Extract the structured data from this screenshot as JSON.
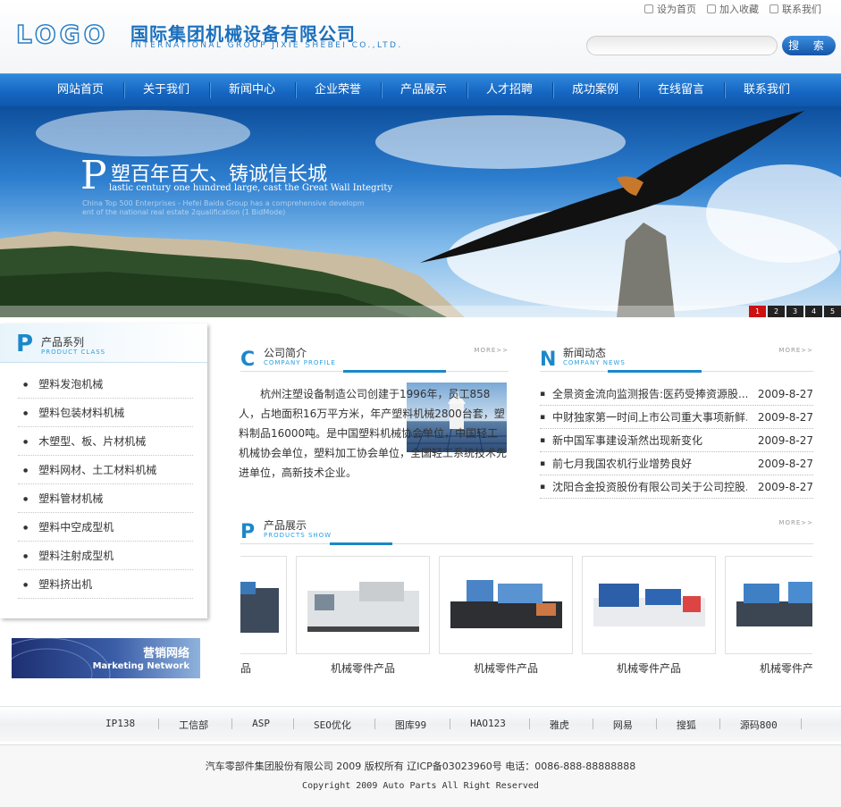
{
  "header": {
    "logo": "LOGO",
    "company_cn": "国际集团机械设备有限公司",
    "company_en": "INTERNATIONAL GROUP  JIXIE SHEBEI CO.,LTD.",
    "top_links": [
      "设为首页",
      "加入收藏",
      "联系我们"
    ],
    "search_button": "搜 索"
  },
  "nav": [
    "网站首页",
    "关于我们",
    "新闻中心",
    "企业荣誉",
    "产品展示",
    "人才招聘",
    "成功案例",
    "在线留言",
    "联系我们"
  ],
  "banner": {
    "slogan_letter": "P",
    "slogan_cn": "塑百年百大、铸诚信长城",
    "slogan_en": "lastic century one hundred large, cast the Great Wall Integrity",
    "sub1": "China Top 500 Enterprises - Hefei Baida Group has a comprehensive developm",
    "sub2": "ent of the national real estate 2qualification (1 BidMode)",
    "slides": [
      "1",
      "2",
      "3",
      "4",
      "5"
    ],
    "active_slide": 1
  },
  "sidebar": {
    "mark": "P",
    "title": "产品系列",
    "subtitle": "PRODUCT CLASS",
    "items": [
      "塑料发泡机械",
      "塑料包装材料机械",
      "木塑型、板、片材机械",
      "塑料网材、土工材料机械",
      "塑料管材机械",
      "塑料中空成型机",
      "塑料注射成型机",
      "塑料挤出机"
    ]
  },
  "marketing": {
    "cn": "营销网络",
    "en": "Marketing Network"
  },
  "profile": {
    "mark": "C",
    "title": "公司简介",
    "subtitle": "COMPANY PROFILE",
    "more": "MORE>>",
    "text": "杭州注塑设备制造公司创建于1996年，员工858人，占地面积16万平方米，年产塑料机械2800台套，塑料制品16000吨。是中国塑料机械协会单位，中国轻工机械协会单位，塑料加工协会单位，全国轻工系统技术先进单位，高新技术企业。"
  },
  "news": {
    "mark": "N",
    "title": "新闻动态",
    "subtitle": "COMPANY NEWS",
    "more": "MORE>>",
    "items": [
      {
        "title": "全景资金流向监测报告:医药受捧资源股...",
        "date": "2009-8-27"
      },
      {
        "title": "中财独家第一时间上市公司重大事项新鲜...",
        "date": "2009-8-27"
      },
      {
        "title": "新中国军事建设渐然出现新变化",
        "date": "2009-8-27"
      },
      {
        "title": "前七月我国农机行业增势良好",
        "date": "2009-8-27"
      },
      {
        "title": "沈阳合金投资股份有限公司关于公司控股...",
        "date": "2009-8-27"
      }
    ]
  },
  "products": {
    "mark": "P",
    "title": "产品展示",
    "subtitle": "PRODUCTS SHOW",
    "more": "MORE>>",
    "items": [
      "品",
      "机械零件产品",
      "机械零件产品",
      "机械零件产品",
      "机械零件产品"
    ]
  },
  "footer": {
    "links": [
      "IP138",
      "工信部",
      "ASP",
      "SEO优化",
      "图库99",
      "HAO123",
      "雅虎",
      "网易",
      "搜狐",
      "源码800"
    ],
    "copyright1": "汽车零部件集团股份有限公司 2009 版权所有 辽ICP备03023960号 电话：0086-888-88888888",
    "copyright2": "Copyright 2009 Auto Parts All Right Reserved"
  },
  "colors": {
    "brand": "#1b88c9",
    "nav": "#1565c0",
    "active_dot": "#cc1111"
  }
}
